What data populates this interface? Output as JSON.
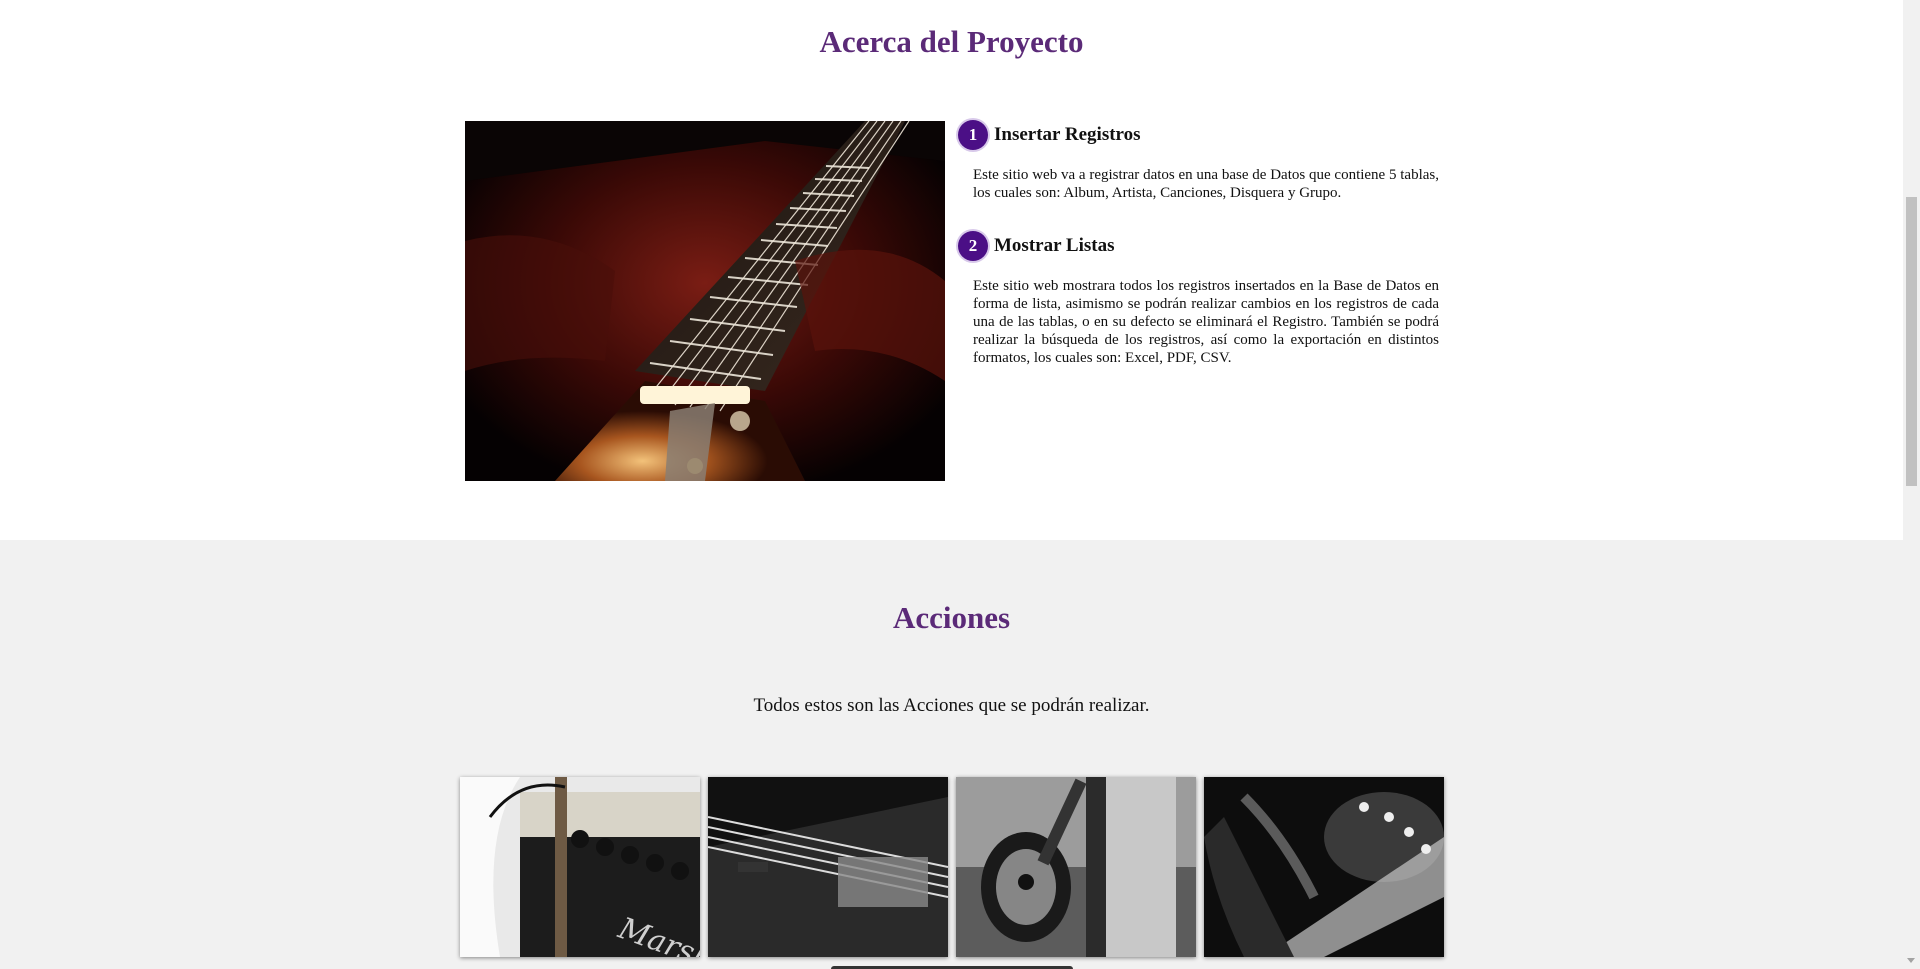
{
  "about": {
    "title": "Acerca del Proyecto",
    "image_icon": "guitar-neck-photo",
    "items": [
      {
        "number": "1",
        "title": "Insertar Registros",
        "text": "Este sitio web va a registrar datos en una base de Datos que contiene 5 tablas, los cuales son: Album, Artista, Canciones, Disquera y Grupo."
      },
      {
        "number": "2",
        "title": "Mostrar Listas",
        "text": "Este sitio web mostrara todos los registros insertados en la Base de Datos en forma de lista, asimismo se podrán realizar cambios en los registros de cada una de las tablas, o en su defecto se eliminará el Registro. También se podrá realizar la búsqueda de los registros, así como la exportación en distintos formatos, los cuales son: Excel, PDF, CSV."
      }
    ]
  },
  "actions": {
    "title": "Acciones",
    "subtitle": "Todos estos son las Acciones que se podrán realizar.",
    "thumbnails": [
      {
        "icon": "guitar-amplifier-photo"
      },
      {
        "icon": "bass-bridge-photo"
      },
      {
        "icon": "guitarist-photo"
      },
      {
        "icon": "guitar-closeup-photo"
      }
    ]
  },
  "colors": {
    "heading": "#5b2a78",
    "badge": "#4b0f86",
    "actions_bg": "#f1f1f1"
  }
}
